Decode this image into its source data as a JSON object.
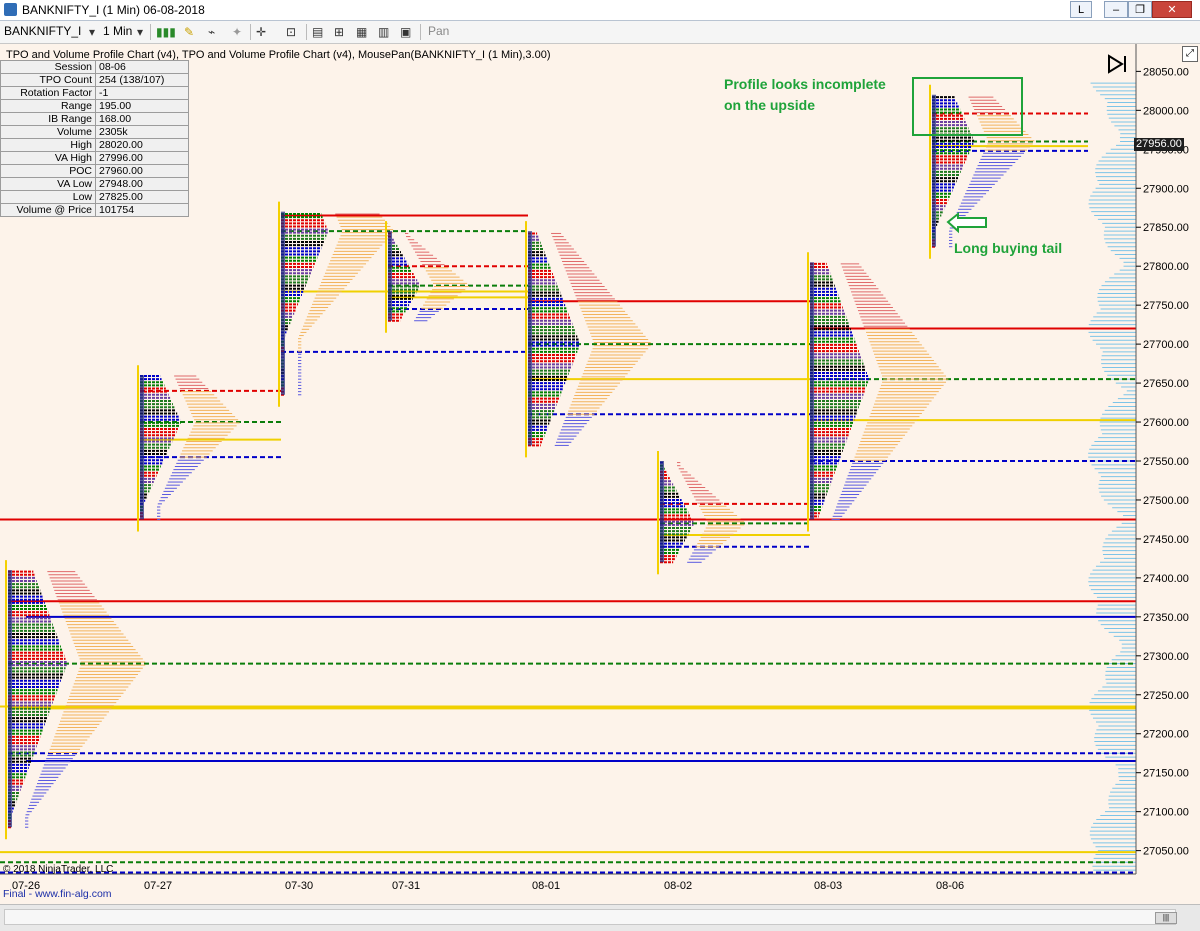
{
  "window": {
    "title": "BANKNIFTY_I (1 Min)  06-08-2018",
    "min_label": "L"
  },
  "toolbar": {
    "instrument": "BANKNIFTY_I",
    "interval": "1 Min",
    "pan_label": "Pan"
  },
  "indicator_line": "TPO and Volume Profile Chart (v4),  TPO and Volume Profile Chart (v4), MousePan(BANKNIFTY_I (1 Min),3.00)",
  "info_table": [
    {
      "key": "Session",
      "value": "08-06"
    },
    {
      "key": "TPO Count",
      "value": "254 (138/107)"
    },
    {
      "key": "Rotation Factor",
      "value": "-1"
    },
    {
      "key": "Range",
      "value": "195.00"
    },
    {
      "key": "IB Range",
      "value": "168.00"
    },
    {
      "key": "Volume",
      "value": "2305k"
    },
    {
      "key": "High",
      "value": "28020.00"
    },
    {
      "key": "VA High",
      "value": "27996.00"
    },
    {
      "key": "POC",
      "value": "27960.00"
    },
    {
      "key": "VA Low",
      "value": "27948.00"
    },
    {
      "key": "Low",
      "value": "27825.00"
    },
    {
      "key": "Volume @ Price",
      "value": "101754"
    }
  ],
  "annotations": {
    "top": [
      "Profile looks incomplete",
      "on the upside"
    ],
    "tail": "Long buying tail"
  },
  "copyright": "© 2018 NinjaTrader, LLC",
  "footer": "Final - www.fin-alg.com",
  "colors": {
    "background": "#fdf3ea",
    "poc": "#0a7d0a",
    "va_high": "#e00000",
    "va_low": "#0000c8",
    "ib": "#f0d000",
    "annotation": "#1fa33a"
  },
  "chart_data": {
    "type": "market-profile",
    "last_price": "27956.00",
    "ylim": [
      27020,
      28080
    ],
    "y_ticks": [
      28050,
      28000,
      27950,
      27900,
      27850,
      27800,
      27750,
      27700,
      27650,
      27600,
      27550,
      27500,
      27450,
      27400,
      27350,
      27300,
      27250,
      27200,
      27150,
      27100,
      27050
    ],
    "y_tick_labels": [
      "28050.00",
      "28000.00",
      "27950.00",
      "27900.00",
      "27850.00",
      "27800.00",
      "27750.00",
      "27700.00",
      "27650.00",
      "27600.00",
      "27550.00",
      "27500.00",
      "27450.00",
      "27400.00",
      "27350.00",
      "27300.00",
      "27250.00",
      "27200.00",
      "27150.00",
      "27100.00",
      "27050.00"
    ],
    "sessions": [
      {
        "date": "07-26",
        "high": 27410,
        "low": 27080,
        "poc": 27290,
        "vah": 27370,
        "val": 27175
      },
      {
        "date": "07-27",
        "high": 27660,
        "low": 27475,
        "poc": 27600,
        "vah": 27640,
        "val": 27555
      },
      {
        "date": "07-30",
        "high": 27870,
        "low": 27635,
        "poc": 27845,
        "vah": 27865,
        "val": 27690
      },
      {
        "date": "07-31",
        "high": 27845,
        "low": 27730,
        "poc": 27775,
        "vah": 27800,
        "val": 27745
      },
      {
        "date": "08-01",
        "high": 27845,
        "low": 27570,
        "poc": 27700,
        "vah": 27755,
        "val": 27610
      },
      {
        "date": "08-02",
        "high": 27550,
        "low": 27420,
        "poc": 27470,
        "vah": 27495,
        "val": 27440
      },
      {
        "date": "08-03",
        "high": 27805,
        "low": 27475,
        "poc": 27655,
        "vah": 27720,
        "val": 27550
      },
      {
        "date": "08-06",
        "high": 28020,
        "low": 27825,
        "poc": 27960,
        "vah": 27996,
        "val": 27948
      }
    ]
  }
}
